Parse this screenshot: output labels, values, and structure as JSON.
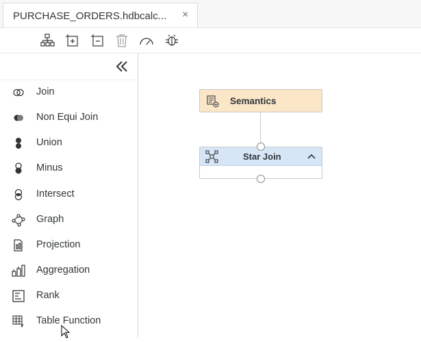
{
  "tab": {
    "title": "PURCHASE_ORDERS.hdbcalc...",
    "close_glyph": "×"
  },
  "toolbar": {
    "icons": [
      "hierarchy-icon",
      "add-node-icon",
      "remove-node-icon",
      "delete-icon",
      "performance-icon",
      "debug-icon"
    ]
  },
  "palette": {
    "collapse_icon": "double-chevron-left-icon",
    "items": [
      {
        "label": "Join",
        "icon": "join-icon"
      },
      {
        "label": "Non Equi Join",
        "icon": "non-equi-join-icon"
      },
      {
        "label": "Union",
        "icon": "union-icon"
      },
      {
        "label": "Minus",
        "icon": "minus-icon"
      },
      {
        "label": "Intersect",
        "icon": "intersect-icon"
      },
      {
        "label": "Graph",
        "icon": "graph-icon"
      },
      {
        "label": "Projection",
        "icon": "projection-icon"
      },
      {
        "label": "Aggregation",
        "icon": "aggregation-icon"
      },
      {
        "label": "Rank",
        "icon": "rank-icon"
      },
      {
        "label": "Table Function",
        "icon": "table-function-icon"
      }
    ]
  },
  "canvas": {
    "semantics_node": {
      "title": "Semantics",
      "color": "#fbe6c8"
    },
    "star_join_node": {
      "title": "Star Join",
      "color": "#d6e6f7"
    }
  },
  "colors": {
    "icon": "#32363a",
    "accent": "#0a6ed1"
  }
}
